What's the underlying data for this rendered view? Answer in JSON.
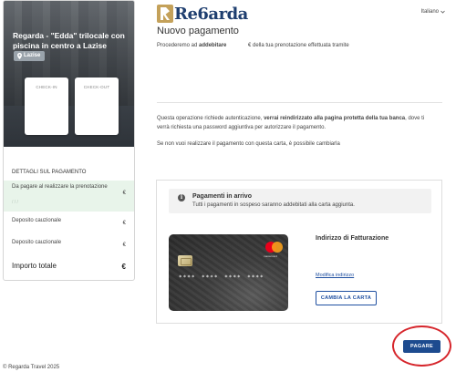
{
  "header": {
    "logo_text": "Re6arda",
    "language": "Italiano",
    "page_title": "Nuovo pagamento",
    "intro_prefix": "Procederemo ad",
    "intro_bold": "addebitare",
    "intro_suffix": "€ della tua prenotazione effettuata tramite"
  },
  "sidebar": {
    "property_title": "Regarda - \"Edda\" trilocale con piscina in centro a Lazise",
    "location": "Lazise",
    "checkin_label": "CHECK-IN",
    "checkout_label": "CHECK-OUT",
    "payment_details_title": "DETTAGLI SUL PAGAMENTO",
    "rows": [
      {
        "label": "Da pagare al realizzare la prenotazione",
        "value": "€",
        "sub": "/ / /"
      },
      {
        "label": "Deposito cauzionale",
        "value": "€"
      },
      {
        "label": "Deposito cauzionale",
        "value": "€"
      }
    ],
    "total_label": "Importo totale",
    "total_value": "€"
  },
  "main": {
    "auth_text_1": "Questa operazione richiede autenticazione,",
    "auth_text_bold": "verrai reindirizzato alla pagina protetta della tua banca",
    "auth_text_2": ", dove ti verrà richiesta una password aggiuntiva per autorizzare il pagamento.",
    "change_text": "Se non vuoi realizzare il pagamento con questa carta, è possibile cambiarla",
    "notice": {
      "title": "Pagamenti in arrivo",
      "subtitle": "Tutti i pagamenti in sospeso saranno addebitati alla carta aggiunta."
    },
    "card": {
      "number_masked": "**** **** **** ****",
      "brand_text": "mastercard"
    },
    "billing_title": "Indirizzo di Fatturazione",
    "billing_link": "Modifica indirizzo",
    "change_card_button": "CAMBIA LA CARTA",
    "pay_button": "PAGARE"
  },
  "footer": {
    "copyright": "© Regarda Travel 2025"
  },
  "colors": {
    "primary": "#1d4b8f",
    "link": "#1f4fa0",
    "highlight_ring": "#d6262c",
    "due_row_bg": "#e8f4ea",
    "logo_gold": "#c4a15a",
    "logo_blue": "#1e3e6f"
  },
  "icons": {
    "location": "map-pin-icon",
    "info": "info-icon",
    "language": "chevron-down-icon"
  }
}
